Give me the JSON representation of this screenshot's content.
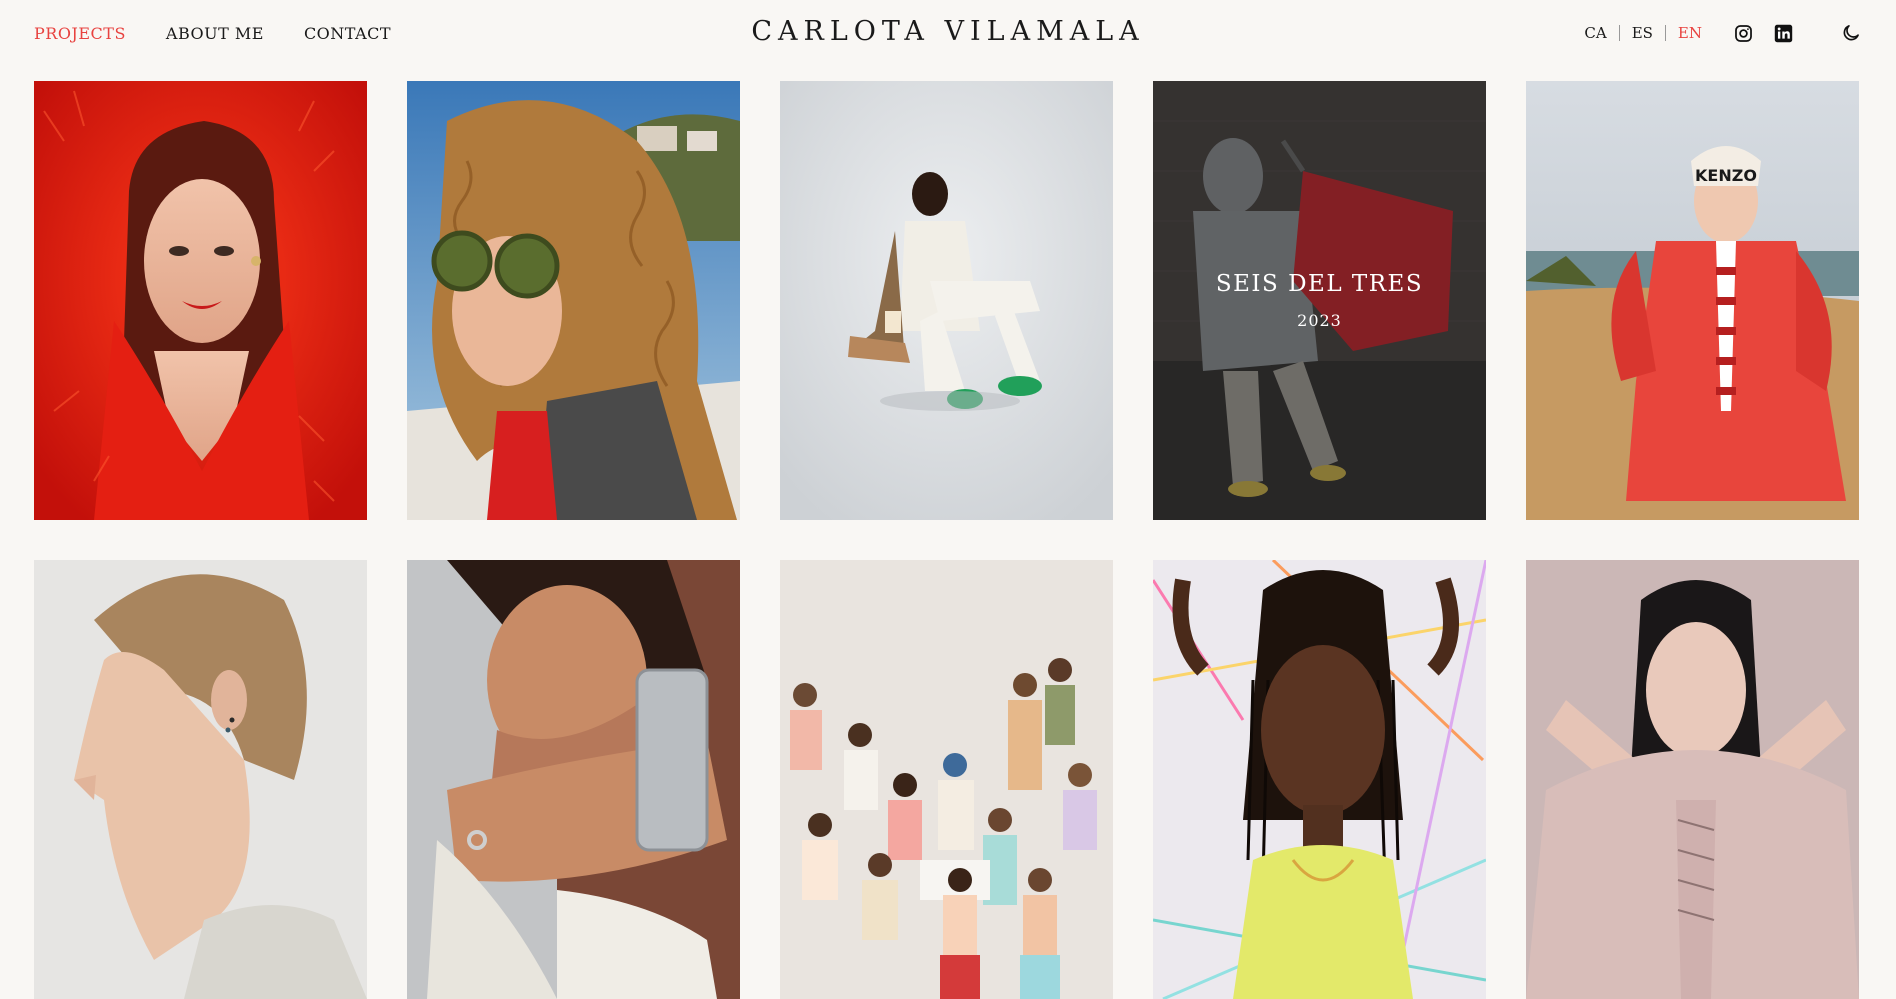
{
  "nav": {
    "projects": "PROJECTS",
    "about": "ABOUT ME",
    "contact": "CONTACT"
  },
  "site_title": "CARLOTA VILAMALA",
  "languages": {
    "ca": "CA",
    "es": "ES",
    "en": "EN",
    "active": "EN"
  },
  "icons": {
    "instagram": "instagram-icon",
    "linkedin": "linkedin-icon",
    "theme": "moon-icon"
  },
  "colors": {
    "accent": "#e8423f",
    "background": "#f9f7f4",
    "text": "#1a1a1a"
  },
  "tiles": [
    {
      "subject": "woman in red fluffy coat"
    },
    {
      "subject": "woman with curly hair and green sunglasses"
    },
    {
      "subject": "man seated with green sneakers"
    },
    {
      "subject": "child carrying red bag",
      "title": "SEIS DEL TRES",
      "year": "2023"
    },
    {
      "subject": "woman in red coat on beach with KENZO hat",
      "hat_text": "KENZO"
    },
    {
      "subject": "profile of woman with short hair"
    },
    {
      "subject": "man holding silver bottle"
    },
    {
      "subject": "group of girls"
    },
    {
      "subject": "woman with braids and yellow top"
    },
    {
      "subject": "woman in pink top with hands at head"
    }
  ]
}
